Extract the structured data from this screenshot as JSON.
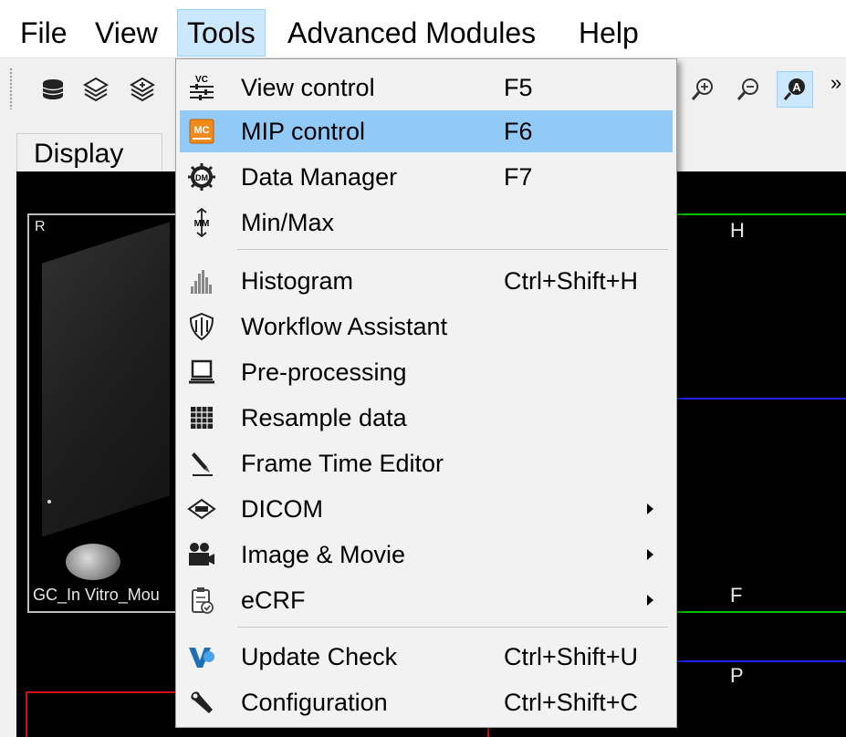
{
  "menubar": {
    "items": [
      {
        "label": "File"
      },
      {
        "label": "View"
      },
      {
        "label": "Tools"
      },
      {
        "label": "Advanced Modules"
      },
      {
        "label": "Help"
      }
    ],
    "open_item": "Tools"
  },
  "toolbar": {
    "more_glyph": "»"
  },
  "panel": {
    "tab_label": "Display",
    "viewports": {
      "left": {
        "orient_top": "R",
        "caption": "GC_In Vitro_Mou"
      },
      "right_top": {
        "orient_top": "H",
        "orient_bottom": "F"
      },
      "right_bottom": {
        "orient_top": "P"
      }
    }
  },
  "tools_menu": {
    "items": [
      {
        "label": "View control",
        "shortcut": "F5",
        "icon": "view-control-icon"
      },
      {
        "label": "MIP control",
        "shortcut": "F6",
        "icon": "mip-control-icon",
        "highlighted": true
      },
      {
        "label": "Data Manager",
        "shortcut": "F7",
        "icon": "data-manager-icon"
      },
      {
        "label": "Min/Max",
        "shortcut": "",
        "icon": "min-max-icon"
      },
      {
        "label": "Histogram",
        "shortcut": "Ctrl+Shift+H",
        "icon": "histogram-icon"
      },
      {
        "label": "Workflow Assistant",
        "shortcut": "",
        "icon": "workflow-assistant-icon"
      },
      {
        "label": "Pre-processing",
        "shortcut": "",
        "icon": "pre-processing-icon"
      },
      {
        "label": "Resample data",
        "shortcut": "",
        "icon": "resample-data-icon"
      },
      {
        "label": "Frame Time Editor",
        "shortcut": "",
        "icon": "frame-time-editor-icon"
      },
      {
        "label": "DICOM",
        "shortcut": "",
        "icon": "dicom-icon",
        "submenu": true
      },
      {
        "label": "Image & Movie",
        "shortcut": "",
        "icon": "image-movie-icon",
        "submenu": true
      },
      {
        "label": "eCRF",
        "shortcut": "",
        "icon": "ecrf-icon",
        "submenu": true
      },
      {
        "label": "Update Check",
        "shortcut": "Ctrl+Shift+U",
        "icon": "update-check-icon"
      },
      {
        "label": "Configuration",
        "shortcut": "Ctrl+Shift+C",
        "icon": "configuration-icon"
      }
    ],
    "icon_labels": {
      "view_control": "VC",
      "mip_control": "MC",
      "data_manager": "DM",
      "min_max": "MM"
    }
  },
  "colors": {
    "highlight": "#91c9f7",
    "menu_open": "#cce8ff",
    "crosshair_green": "#00c000",
    "crosshair_blue": "#2020ff",
    "crosshair_red": "#d01010"
  }
}
